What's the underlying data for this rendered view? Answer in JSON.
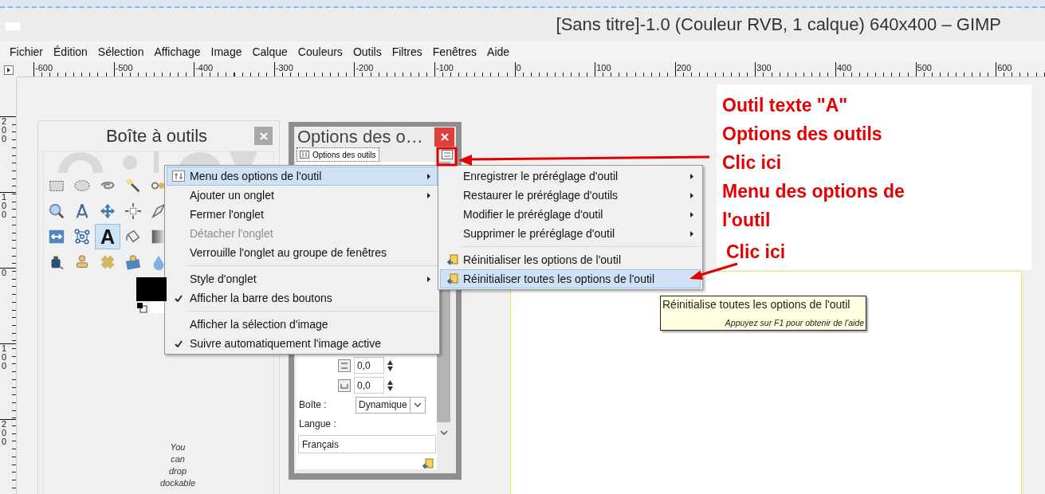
{
  "window": {
    "title": "[Sans titre]-1.0 (Couleur RVB, 1 calque) 640x400 – GIMP"
  },
  "menubar": [
    "Fichier",
    "Édition",
    "Sélection",
    "Affichage",
    "Image",
    "Calque",
    "Couleurs",
    "Outils",
    "Filtres",
    "Fenêtres",
    "Aide"
  ],
  "rulers": {
    "horizontal": [
      "-600",
      "-500",
      "-400",
      "-300",
      "-200",
      "-100",
      "0",
      "100",
      "200",
      "300",
      "400",
      "500",
      "600"
    ],
    "vertical": [
      "200",
      "100",
      "0",
      "100",
      "200"
    ]
  },
  "toolbox": {
    "title": "Boîte à outils",
    "tools": [
      {
        "selected": false
      },
      {
        "selected": false
      },
      {
        "selected": false
      },
      {
        "selected": false
      },
      {
        "selected": false
      },
      {
        "selected": false
      },
      {
        "selected": false
      },
      {
        "selected": false
      },
      {
        "selected": false
      },
      {
        "selected": false
      },
      {
        "selected": false
      },
      {
        "selected": false
      },
      {
        "selected": true,
        "glyph": "A"
      },
      {
        "selected": false
      },
      {
        "selected": false
      },
      {
        "selected": false
      },
      {
        "selected": false
      },
      {
        "selected": false
      },
      {
        "selected": false
      },
      {
        "selected": false
      }
    ],
    "drop_hint": "You can drop dockable"
  },
  "tool_options": {
    "title": "Options des o…",
    "tab": "Options des outils",
    "spinners": [
      "0,0",
      "0,0"
    ],
    "box_label": "Boîte :",
    "box_value": "Dynamique",
    "language_label": "Langue :",
    "language_value": "Français"
  },
  "context_menu": {
    "groups": [
      [
        {
          "kind": "options",
          "label": "Menu des options de l'outil",
          "submenu": true,
          "checked": false,
          "disabled": false,
          "selected": true
        },
        {
          "kind": "plain",
          "label": "Ajouter un onglet",
          "submenu": true,
          "checked": false,
          "disabled": false,
          "selected": false
        },
        {
          "kind": "plain",
          "label": "Fermer l'onglet",
          "submenu": false,
          "checked": false,
          "disabled": false,
          "selected": false
        },
        {
          "kind": "plain",
          "label": "Détacher l'onglet",
          "submenu": false,
          "checked": false,
          "disabled": true,
          "selected": false
        },
        {
          "kind": "plain",
          "label": "Verrouille l'onglet au groupe de fenêtres",
          "submenu": false,
          "checked": false,
          "disabled": false,
          "selected": false
        }
      ],
      [
        {
          "kind": "plain",
          "label": "Style d'onglet",
          "submenu": true,
          "checked": false,
          "disabled": false,
          "selected": false
        },
        {
          "kind": "plain",
          "label": "Afficher la barre des boutons",
          "submenu": false,
          "checked": true,
          "disabled": false,
          "selected": false
        }
      ],
      [
        {
          "kind": "plain",
          "label": "Afficher la sélection d'image",
          "submenu": false,
          "checked": false,
          "disabled": false,
          "selected": false
        },
        {
          "kind": "plain",
          "label": "Suivre automatiquement l'image active",
          "submenu": false,
          "checked": true,
          "disabled": false,
          "selected": false
        }
      ]
    ]
  },
  "submenu": {
    "groups": [
      [
        {
          "kind": "plain",
          "label": "Enregistrer le préréglage d'outil",
          "submenu": true,
          "selected": false
        },
        {
          "kind": "plain",
          "label": "Restaurer le préréglage d'outils",
          "submenu": true,
          "selected": false
        },
        {
          "kind": "plain",
          "label": "Modifier le préréglage d'outil",
          "submenu": true,
          "selected": false
        },
        {
          "kind": "plain",
          "label": "Supprimer le préréglage d'outil",
          "submenu": true,
          "selected": false
        }
      ],
      [
        {
          "kind": "reset",
          "label": "Réinitialiser les options de l'outil",
          "submenu": false,
          "selected": false
        },
        {
          "kind": "reset",
          "label": "Réinitialiser toutes les options de l'outil",
          "submenu": false,
          "selected": true
        }
      ]
    ]
  },
  "tooltip": {
    "text": "Réinitialise toutes les options de l'outil",
    "hint": "Appuyez sur F1 pour obtenir de l'aide"
  },
  "annotations": {
    "lines": [
      "Outil texte \"A\"",
      "Options des outils",
      "Clic ici",
      "Menu des options de",
      "l'outil"
    ],
    "callout": "Clic ici"
  }
}
